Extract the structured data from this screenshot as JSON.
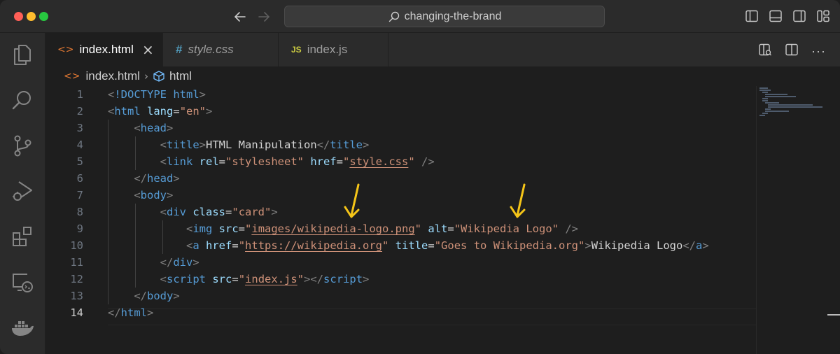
{
  "window": {
    "command_center": "changing-the-brand",
    "back_icon": "arrow-left-icon",
    "forward_icon": "arrow-right-icon"
  },
  "activity_bar": [
    "explorer-icon",
    "search-icon",
    "source-control-icon",
    "run-debug-icon",
    "extensions-icon",
    "remote-explorer-icon",
    "docker-icon"
  ],
  "tabs": [
    {
      "label": "index.html",
      "icon": "<>",
      "active": true,
      "close": "×"
    },
    {
      "label": "style.css",
      "icon": "#",
      "active": false
    },
    {
      "label": "index.js",
      "icon": "JS",
      "active": false
    }
  ],
  "editor_actions": {
    "more": "···"
  },
  "breadcrumb": {
    "icon": "<>",
    "file": "index.html",
    "sep": "›",
    "element": "html"
  },
  "lines": [
    {
      "n": "1",
      "indent": 0,
      "tokens": [
        [
          "tk-br",
          "<"
        ],
        [
          "tk-tag",
          "!DOCTYPE"
        ],
        [
          "tk-txt",
          " "
        ],
        [
          "tk-tag",
          "html"
        ],
        [
          "tk-br",
          ">"
        ]
      ]
    },
    {
      "n": "2",
      "indent": 0,
      "tokens": [
        [
          "tk-br",
          "<"
        ],
        [
          "tk-tag",
          "html"
        ],
        [
          "tk-txt",
          " "
        ],
        [
          "tk-attr",
          "lang"
        ],
        [
          "tk-eq",
          "="
        ],
        [
          "tk-str",
          "\"en\""
        ],
        [
          "tk-br",
          ">"
        ]
      ]
    },
    {
      "n": "3",
      "indent": 1,
      "tokens": [
        [
          "tk-br",
          "<"
        ],
        [
          "tk-tag",
          "head"
        ],
        [
          "tk-br",
          ">"
        ]
      ]
    },
    {
      "n": "4",
      "indent": 2,
      "tokens": [
        [
          "tk-br",
          "<"
        ],
        [
          "tk-tag",
          "title"
        ],
        [
          "tk-br",
          ">"
        ],
        [
          "tk-txt",
          "HTML Manipulation"
        ],
        [
          "tk-br",
          "</"
        ],
        [
          "tk-tag",
          "title"
        ],
        [
          "tk-br",
          ">"
        ]
      ]
    },
    {
      "n": "5",
      "indent": 2,
      "tokens": [
        [
          "tk-br",
          "<"
        ],
        [
          "tk-tag",
          "link"
        ],
        [
          "tk-txt",
          " "
        ],
        [
          "tk-attr",
          "rel"
        ],
        [
          "tk-eq",
          "="
        ],
        [
          "tk-str",
          "\"stylesheet\""
        ],
        [
          "tk-txt",
          " "
        ],
        [
          "tk-attr",
          "href"
        ],
        [
          "tk-eq",
          "="
        ],
        [
          "tk-str",
          "\""
        ],
        [
          "tk-str ul",
          "style.css"
        ],
        [
          "tk-str",
          "\""
        ],
        [
          "tk-txt",
          " "
        ],
        [
          "tk-br",
          "/>"
        ]
      ]
    },
    {
      "n": "6",
      "indent": 1,
      "tokens": [
        [
          "tk-br",
          "</"
        ],
        [
          "tk-tag",
          "head"
        ],
        [
          "tk-br",
          ">"
        ]
      ]
    },
    {
      "n": "7",
      "indent": 1,
      "tokens": [
        [
          "tk-br",
          "<"
        ],
        [
          "tk-tag",
          "body"
        ],
        [
          "tk-br",
          ">"
        ]
      ]
    },
    {
      "n": "8",
      "indent": 2,
      "tokens": [
        [
          "tk-br",
          "<"
        ],
        [
          "tk-tag",
          "div"
        ],
        [
          "tk-txt",
          " "
        ],
        [
          "tk-attr",
          "class"
        ],
        [
          "tk-eq",
          "="
        ],
        [
          "tk-str",
          "\"card\""
        ],
        [
          "tk-br",
          ">"
        ]
      ]
    },
    {
      "n": "9",
      "indent": 3,
      "tokens": [
        [
          "tk-br",
          "<"
        ],
        [
          "tk-tag",
          "img"
        ],
        [
          "tk-txt",
          " "
        ],
        [
          "tk-attr",
          "src"
        ],
        [
          "tk-eq",
          "="
        ],
        [
          "tk-str",
          "\""
        ],
        [
          "tk-str ul",
          "images/wikipedia-logo.png"
        ],
        [
          "tk-str",
          "\""
        ],
        [
          "tk-txt",
          " "
        ],
        [
          "tk-attr",
          "alt"
        ],
        [
          "tk-eq",
          "="
        ],
        [
          "tk-str",
          "\"Wikipedia Logo\""
        ],
        [
          "tk-txt",
          " "
        ],
        [
          "tk-br",
          "/>"
        ]
      ]
    },
    {
      "n": "10",
      "indent": 3,
      "tokens": [
        [
          "tk-br",
          "<"
        ],
        [
          "tk-tag",
          "a"
        ],
        [
          "tk-txt",
          " "
        ],
        [
          "tk-attr",
          "href"
        ],
        [
          "tk-eq",
          "="
        ],
        [
          "tk-str",
          "\""
        ],
        [
          "tk-str ul",
          "https://wikipedia.org"
        ],
        [
          "tk-str",
          "\""
        ],
        [
          "tk-txt",
          " "
        ],
        [
          "tk-attr",
          "title"
        ],
        [
          "tk-eq",
          "="
        ],
        [
          "tk-str",
          "\"Goes to Wikipedia.org\""
        ],
        [
          "tk-br",
          ">"
        ],
        [
          "tk-txt",
          "Wikipedia Logo"
        ],
        [
          "tk-br",
          "</"
        ],
        [
          "tk-tag",
          "a"
        ],
        [
          "tk-br",
          ">"
        ]
      ]
    },
    {
      "n": "11",
      "indent": 2,
      "tokens": [
        [
          "tk-br",
          "</"
        ],
        [
          "tk-tag",
          "div"
        ],
        [
          "tk-br",
          ">"
        ]
      ]
    },
    {
      "n": "12",
      "indent": 2,
      "tokens": [
        [
          "tk-br",
          "<"
        ],
        [
          "tk-tag",
          "script"
        ],
        [
          "tk-txt",
          " "
        ],
        [
          "tk-attr",
          "src"
        ],
        [
          "tk-eq",
          "="
        ],
        [
          "tk-str",
          "\""
        ],
        [
          "tk-str ul",
          "index.js"
        ],
        [
          "tk-str",
          "\""
        ],
        [
          "tk-br",
          "></"
        ],
        [
          "tk-tag",
          "script"
        ],
        [
          "tk-br",
          ">"
        ]
      ]
    },
    {
      "n": "13",
      "indent": 1,
      "tokens": [
        [
          "tk-br",
          "</"
        ],
        [
          "tk-tag",
          "body"
        ],
        [
          "tk-br",
          ">"
        ]
      ]
    },
    {
      "n": "14",
      "indent": 0,
      "current": true,
      "tokens": [
        [
          "tk-br",
          "</"
        ],
        [
          "tk-tag",
          "html"
        ],
        [
          "tk-br",
          ">"
        ]
      ]
    }
  ],
  "annotations": {
    "arrow_color": "#f5c518",
    "count": 2
  }
}
